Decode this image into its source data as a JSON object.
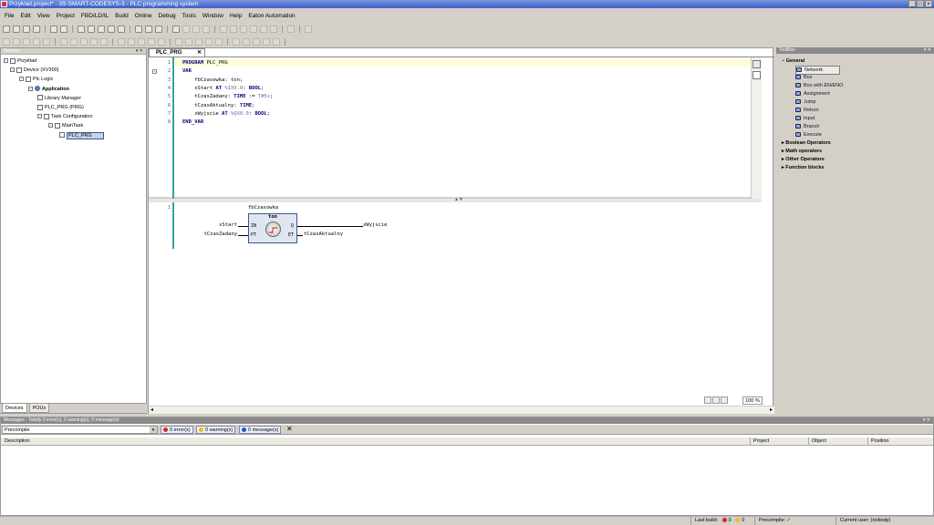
{
  "window": {
    "title": "Przyklad.project* - 3S-SMART-CODESYS-3 - PLC programming system"
  },
  "menu": [
    "File",
    "Edit",
    "View",
    "Project",
    "FBD/LD/IL",
    "Build",
    "Online",
    "Debug",
    "Tools",
    "Window",
    "Help",
    "Eaton Automation"
  ],
  "devices_panel": {
    "title": "Devices",
    "tree": [
      {
        "label": "Przyklad",
        "level": 0,
        "icon": "project-icon"
      },
      {
        "label": "Device (XV300)",
        "level": 1,
        "icon": "device-icon"
      },
      {
        "label": "Plc Logic",
        "level": 2,
        "icon": "plc-logic-icon"
      },
      {
        "label": "Application",
        "level": 3,
        "icon": "application-icon"
      },
      {
        "label": "Library Manager",
        "level": 4,
        "icon": "library-icon"
      },
      {
        "label": "PLC_PRG (PRG)",
        "level": 4,
        "icon": "pou-icon"
      },
      {
        "label": "Task Configuration",
        "level": 4,
        "icon": "task-config-icon"
      },
      {
        "label": "MainTask",
        "level": 5,
        "icon": "task-icon"
      },
      {
        "label": "PLC_PRG",
        "level": 6,
        "icon": "pou-call-icon"
      }
    ],
    "tabs": [
      "Devices",
      "POUs"
    ]
  },
  "editor": {
    "tab_label": "PLC_PRG",
    "declaration_lines": [
      {
        "n": "1",
        "segs": [
          {
            "t": "PROGRAM",
            "c": "kw"
          },
          {
            "t": " PLC_PRG",
            "c": ""
          }
        ]
      },
      {
        "n": "2",
        "segs": [
          {
            "t": "VAR",
            "c": "kw"
          }
        ]
      },
      {
        "n": "3",
        "segs": [
          {
            "t": "    fbCzasowka: ton;",
            "c": ""
          }
        ]
      },
      {
        "n": "4",
        "segs": [
          {
            "t": "    xStart ",
            "c": ""
          },
          {
            "t": "AT",
            "c": "kw"
          },
          {
            "t": " %IX0.0",
            "c": "addr"
          },
          {
            "t": ": ",
            "c": ""
          },
          {
            "t": "BOOL",
            "c": "kw"
          },
          {
            "t": ";",
            "c": ""
          }
        ]
      },
      {
        "n": "5",
        "segs": [
          {
            "t": "    tCzasZadany: ",
            "c": ""
          },
          {
            "t": "TIME",
            "c": "kw"
          },
          {
            "t": " := ",
            "c": ""
          },
          {
            "t": "T#5s",
            "c": "addr"
          },
          {
            "t": ";",
            "c": ""
          }
        ]
      },
      {
        "n": "6",
        "segs": [
          {
            "t": "    tCzasAktualny: ",
            "c": ""
          },
          {
            "t": "TIME",
            "c": "kw"
          },
          {
            "t": ";",
            "c": ""
          }
        ]
      },
      {
        "n": "7",
        "segs": [
          {
            "t": "    xWyjscie ",
            "c": ""
          },
          {
            "t": "AT",
            "c": "kw"
          },
          {
            "t": " %QX0.0",
            "c": "addr"
          },
          {
            "t": ": ",
            "c": ""
          },
          {
            "t": "BOOL",
            "c": "kw"
          },
          {
            "t": ";",
            "c": ""
          }
        ]
      },
      {
        "n": "8",
        "segs": [
          {
            "t": "END_VAR",
            "c": "kw"
          }
        ]
      }
    ],
    "network_number": "1",
    "fb": {
      "instance": "fbCzasowka",
      "type": "ton",
      "pin_in": "IN",
      "pin_pt": "PT",
      "pin_q": "Q",
      "pin_et": "ET",
      "in_var": "xStart",
      "pt_var": "tCzasZadany",
      "q_var": "xWyjscie",
      "et_var": "tCzasAktualny"
    },
    "zoom": "100 %"
  },
  "toolbox": {
    "title": "ToolBox",
    "general_label": "General",
    "general_items": [
      "Network",
      "Box",
      "Box with EN/ENO",
      "Assignment",
      "Jump",
      "Return",
      "Input",
      "Branch",
      "Execute"
    ],
    "collapsed_categories": [
      "Boolean Operators",
      "Math operators",
      "Other Operators",
      "Function blocks"
    ]
  },
  "messages": {
    "header": "Messages - Totally 0 error(s), 0 warning(s), 0 message(s)",
    "filter": "Precompile",
    "errors_btn": "0 error(s)",
    "warnings_btn": "0 warning(s)",
    "messages_btn": "0 message(s)",
    "columns": [
      "Description",
      "Project",
      "Object",
      "Position"
    ]
  },
  "statusbar": {
    "last_build_label": "Last build:",
    "errors_count": "0",
    "warnings_count": "0",
    "precompile_label": "Precompile:",
    "current_user": "Current user: (nobody)"
  },
  "colors": {
    "keyword": "#000080",
    "gutter": "#39a0a0",
    "title_bar": "#3a5ec4"
  }
}
